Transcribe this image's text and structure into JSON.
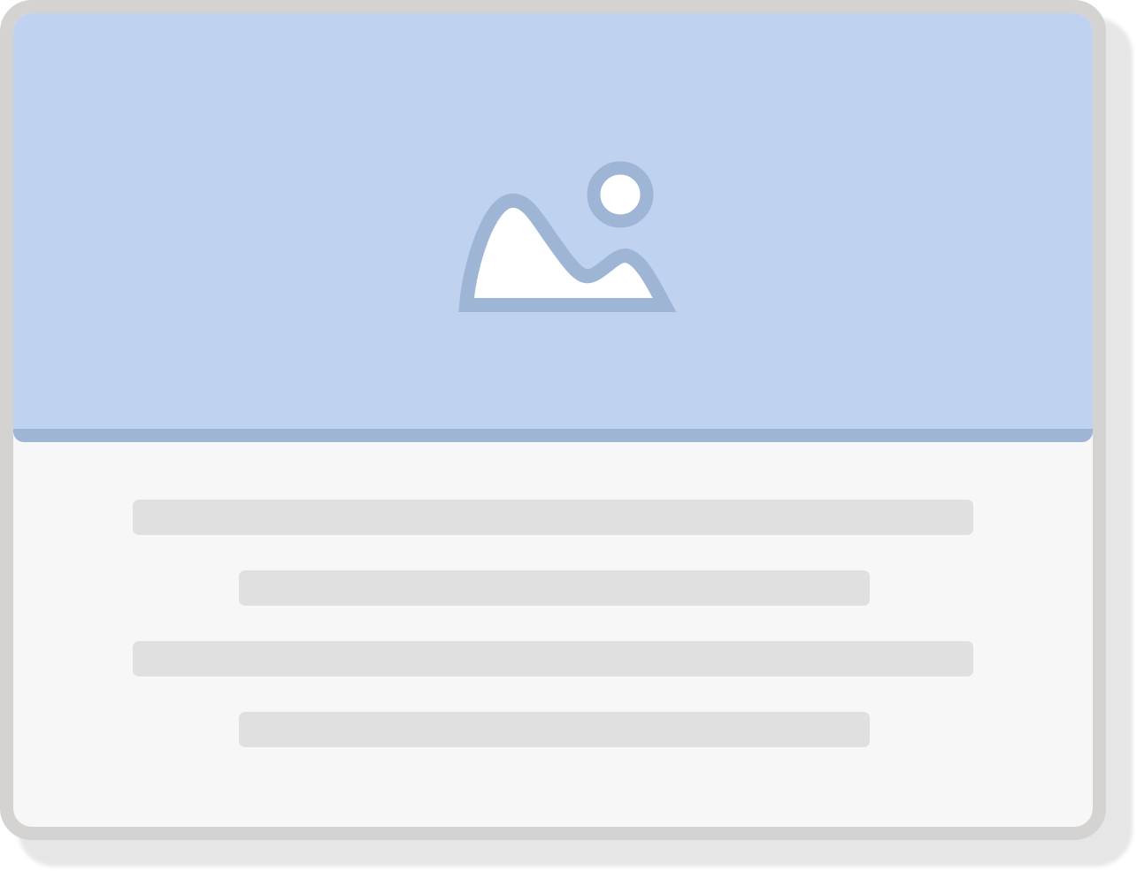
{
  "colors": {
    "frame": "#d4d3d2",
    "card_background": "#f7f7f7",
    "hero_background": "#bfd3f0",
    "hero_accent": "#9fb5d5",
    "placeholder_line": "#e0e0e0",
    "icon_fill": "#ffffff"
  },
  "hero": {
    "icon": "image-placeholder-icon"
  },
  "body": {
    "lines": [
      {
        "name": "text-line-1",
        "style": "long"
      },
      {
        "name": "text-line-2",
        "style": "short"
      },
      {
        "name": "text-line-3",
        "style": "long"
      },
      {
        "name": "text-line-4",
        "style": "short"
      }
    ]
  }
}
